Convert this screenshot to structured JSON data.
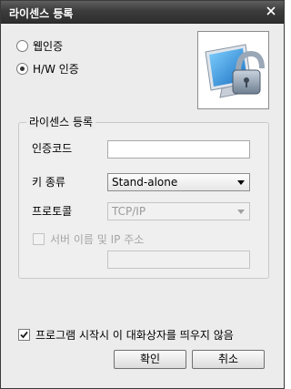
{
  "window": {
    "title": "라이센스 등록"
  },
  "auth_mode": {
    "options": [
      {
        "label": "웹인증",
        "checked": false
      },
      {
        "label": "H/W 인증",
        "checked": true
      }
    ]
  },
  "illustration": {
    "icon": "computer-lock-icon"
  },
  "license_group": {
    "legend": "라이센스 등록",
    "auth_code": {
      "label": "인증코드",
      "value": ""
    },
    "key_type": {
      "label": "키 종류",
      "selected": "Stand-alone"
    },
    "protocol": {
      "label": "프로토콜",
      "selected": "TCP/IP"
    },
    "server": {
      "label": "서버 이름 및 IP 주소",
      "checked": false,
      "value": ""
    }
  },
  "startup_checkbox": {
    "label": "프로그램 시작시 이 대화상자를 띄우지 않음",
    "checked": true
  },
  "buttons": {
    "ok": "확인",
    "cancel": "취소"
  },
  "colors": {
    "titlebar": "#3c3c3c",
    "dialog_bg": "#ececec",
    "monitor_screen": "#2c8fd6"
  }
}
